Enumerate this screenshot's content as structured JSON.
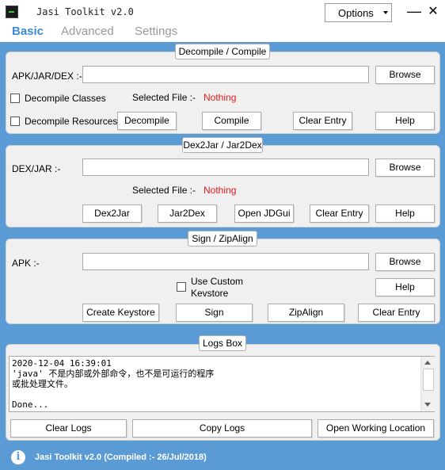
{
  "window": {
    "title": "Jasi Toolkit v2.0",
    "options_label": "Options",
    "minimize_glyph": "—",
    "close_glyph": "✕"
  },
  "tabs": [
    {
      "label": "Basic",
      "active": true
    },
    {
      "label": "Advanced",
      "active": false
    },
    {
      "label": "Settings",
      "active": false
    }
  ],
  "decompile_compile": {
    "legend": "Decompile / Compile",
    "input_label": "APK/JAR/DEX :-",
    "input_value": "",
    "browse": "Browse",
    "decompile_classes": {
      "label": "Decompile Classes",
      "checked": false
    },
    "decompile_resources": {
      "label": "Decompile Resources",
      "checked": false
    },
    "selected_file_label": "Selected File :-",
    "selected_file_value": "Nothing",
    "decompile": "Decompile",
    "compile": "Compile",
    "clear_entry": "Clear Entry",
    "help": "Help"
  },
  "dex2jar": {
    "legend": "Dex2Jar / Jar2Dex",
    "input_label": "DEX/JAR :-",
    "input_value": "",
    "browse": "Browse",
    "selected_file_label": "Selected File :-",
    "selected_file_value": "Nothing",
    "dex2jar": "Dex2Jar",
    "jar2dex": "Jar2Dex",
    "open_jdgui": "Open JDGui",
    "clear_entry": "Clear Entry",
    "help": "Help"
  },
  "sign_zipalign": {
    "legend": "Sign / ZipAlign",
    "input_label": "APK :-",
    "input_value": "",
    "browse": "Browse",
    "use_custom_keystore_line1": "Use Custom",
    "use_custom_keystore_line2": "Kevstore",
    "use_custom_checked": false,
    "help": "Help",
    "create_keystore": "Create Keystore",
    "sign": "Sign",
    "zipalign": "ZipAlign",
    "clear_entry": "Clear Entry"
  },
  "logs": {
    "legend": "Logs Box",
    "text": "2020-12-04 16:39:01\n'java' 不是内部或外部命令，也不是可运行的程序\n或批处理文件。\n\nDone...",
    "clear_logs": "Clear Logs",
    "copy_logs": "Copy Logs",
    "open_working_location": "Open Working Location"
  },
  "footer": {
    "info_glyph": "i",
    "text": "Jasi Toolkit v2.0 (Compiled :- 26/Jul/2018)"
  },
  "colors": {
    "accent_blue": "#5b9bd5",
    "active_tab": "#3d8bd6",
    "nothing_red": "#e01b1b",
    "panel_bg": "#f0f0f0"
  }
}
